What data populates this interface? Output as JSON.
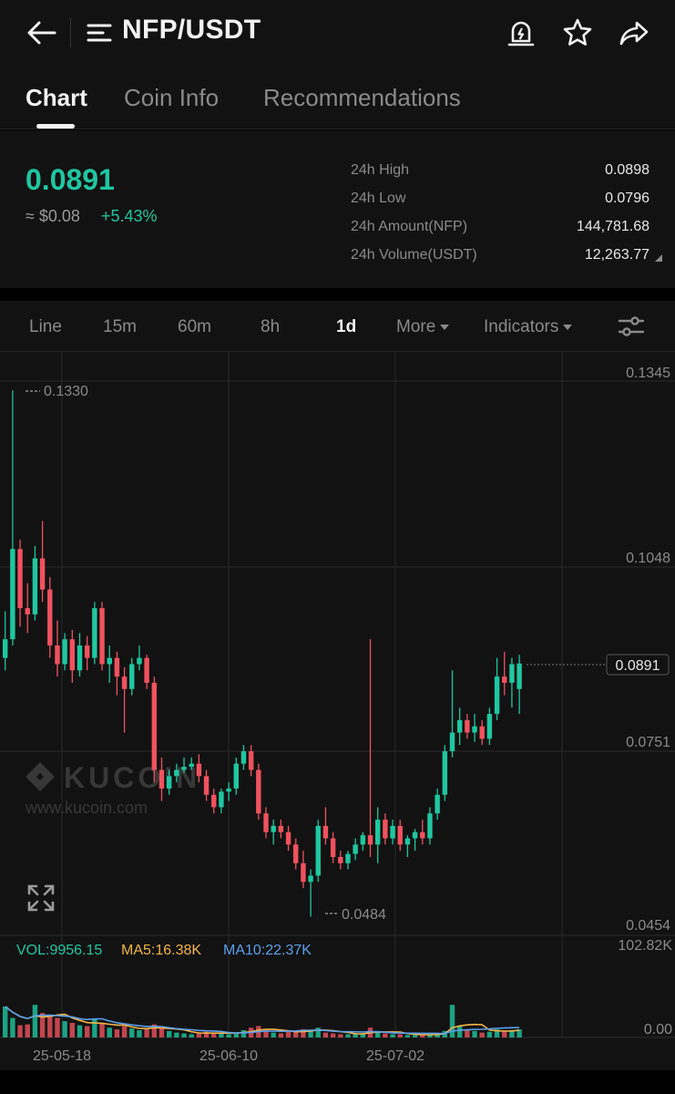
{
  "header": {
    "pair": "NFP/USDT",
    "icons": [
      "back-arrow-icon",
      "menu-icon",
      "price-alert-icon",
      "star-icon",
      "share-icon"
    ]
  },
  "tabs": [
    {
      "label": "Chart",
      "active": true
    },
    {
      "label": "Coin Info",
      "active": false
    },
    {
      "label": "Recommendations",
      "active": false
    }
  ],
  "ticker": {
    "last_price": "0.0891",
    "fiat_price": "≈ $0.08",
    "change_pct": "+5.43%",
    "stats": [
      {
        "label": "24h High",
        "value": "0.0898"
      },
      {
        "label": "24h Low",
        "value": "0.0796"
      },
      {
        "label": "24h Amount(NFP)",
        "value": "144,781.68"
      },
      {
        "label": "24h Volume(USDT)",
        "value": "12,263.77"
      }
    ]
  },
  "intervals": {
    "items": [
      {
        "label": "Line",
        "active": false
      },
      {
        "label": "15m",
        "active": false
      },
      {
        "label": "60m",
        "active": false
      },
      {
        "label": "8h",
        "active": false
      },
      {
        "label": "1d",
        "active": true
      }
    ],
    "more": "More",
    "indicators": "Indicators"
  },
  "colors": {
    "up": "#1fc7a0",
    "down": "#f0525e",
    "ma5": "#f4b547",
    "ma10": "#5aa0ec",
    "background": "#121212"
  },
  "watermark": {
    "brand": "KUCOIN",
    "url": "www.kucoin.com"
  },
  "chart_data": {
    "type": "candlestick",
    "interval": "1d",
    "price_axis_ticks": [
      "0.1345",
      "0.1048",
      "0.0751",
      "0.0454"
    ],
    "ylim": [
      0.0454,
      0.1345
    ],
    "current_price_label": "0.0891",
    "max_marker": "0.1330",
    "min_marker": "0.0484",
    "x_tick_labels": [
      "25-05-18",
      "25-06-10",
      "25-07-02"
    ],
    "volume": {
      "vol_label": "VOL:9956.15",
      "ma5_label": "MA5:16.38K",
      "ma10_label": "MA10:22.37K",
      "axis_ticks": [
        "102.82K",
        "0.00"
      ],
      "ylim": [
        0,
        102820
      ]
    },
    "candles": [
      [
        0.09,
        0.0975,
        0.088,
        0.093,
        38
      ],
      [
        0.093,
        0.133,
        0.092,
        0.1075,
        24
      ],
      [
        0.1075,
        0.109,
        0.095,
        0.098,
        15
      ],
      [
        0.098,
        0.102,
        0.094,
        0.097,
        16
      ],
      [
        0.097,
        0.108,
        0.096,
        0.106,
        40
      ],
      [
        0.106,
        0.112,
        0.099,
        0.101,
        30
      ],
      [
        0.101,
        0.103,
        0.09,
        0.092,
        28
      ],
      [
        0.092,
        0.096,
        0.087,
        0.089,
        24
      ],
      [
        0.089,
        0.094,
        0.088,
        0.093,
        20
      ],
      [
        0.093,
        0.0945,
        0.086,
        0.088,
        18
      ],
      [
        0.088,
        0.094,
        0.087,
        0.092,
        15
      ],
      [
        0.092,
        0.0935,
        0.088,
        0.09,
        14
      ],
      [
        0.09,
        0.099,
        0.089,
        0.098,
        22
      ],
      [
        0.098,
        0.099,
        0.088,
        0.089,
        18
      ],
      [
        0.089,
        0.092,
        0.086,
        0.09,
        12
      ],
      [
        0.09,
        0.091,
        0.084,
        0.087,
        10
      ],
      [
        0.087,
        0.0885,
        0.078,
        0.085,
        14
      ],
      [
        0.085,
        0.09,
        0.084,
        0.089,
        11
      ],
      [
        0.089,
        0.092,
        0.088,
        0.09,
        9
      ],
      [
        0.09,
        0.0905,
        0.085,
        0.086,
        10
      ],
      [
        0.086,
        0.087,
        0.07,
        0.072,
        16
      ],
      [
        0.072,
        0.074,
        0.067,
        0.069,
        12
      ],
      [
        0.069,
        0.072,
        0.068,
        0.071,
        8
      ],
      [
        0.071,
        0.073,
        0.07,
        0.072,
        6
      ],
      [
        0.072,
        0.074,
        0.0715,
        0.0725,
        5
      ],
      [
        0.0725,
        0.074,
        0.072,
        0.073,
        4
      ],
      [
        0.073,
        0.0745,
        0.07,
        0.071,
        5
      ],
      [
        0.071,
        0.072,
        0.067,
        0.068,
        7
      ],
      [
        0.068,
        0.069,
        0.065,
        0.066,
        6
      ],
      [
        0.066,
        0.069,
        0.065,
        0.0685,
        5
      ],
      [
        0.0685,
        0.07,
        0.067,
        0.069,
        4
      ],
      [
        0.069,
        0.074,
        0.068,
        0.073,
        6
      ],
      [
        0.073,
        0.076,
        0.072,
        0.075,
        9
      ],
      [
        0.075,
        0.076,
        0.071,
        0.072,
        12
      ],
      [
        0.072,
        0.073,
        0.064,
        0.065,
        14
      ],
      [
        0.065,
        0.066,
        0.061,
        0.062,
        9
      ],
      [
        0.062,
        0.064,
        0.06,
        0.063,
        6
      ],
      [
        0.063,
        0.064,
        0.061,
        0.062,
        5
      ],
      [
        0.062,
        0.063,
        0.059,
        0.06,
        7
      ],
      [
        0.06,
        0.061,
        0.056,
        0.057,
        8
      ],
      [
        0.057,
        0.059,
        0.053,
        0.054,
        10
      ],
      [
        0.054,
        0.056,
        0.0484,
        0.055,
        9
      ],
      [
        0.055,
        0.064,
        0.054,
        0.063,
        12
      ],
      [
        0.063,
        0.066,
        0.06,
        0.061,
        6
      ],
      [
        0.061,
        0.062,
        0.057,
        0.058,
        5
      ],
      [
        0.058,
        0.059,
        0.056,
        0.057,
        4
      ],
      [
        0.057,
        0.059,
        0.056,
        0.0585,
        4
      ],
      [
        0.0585,
        0.061,
        0.0575,
        0.06,
        4
      ],
      [
        0.06,
        0.062,
        0.059,
        0.0615,
        5
      ],
      [
        0.0615,
        0.093,
        0.058,
        0.06,
        12
      ],
      [
        0.06,
        0.066,
        0.057,
        0.064,
        8
      ],
      [
        0.064,
        0.065,
        0.06,
        0.061,
        5
      ],
      [
        0.061,
        0.064,
        0.06,
        0.063,
        4
      ],
      [
        0.063,
        0.064,
        0.059,
        0.06,
        4
      ],
      [
        0.06,
        0.0615,
        0.058,
        0.061,
        3
      ],
      [
        0.061,
        0.0625,
        0.059,
        0.062,
        3
      ],
      [
        0.062,
        0.064,
        0.06,
        0.061,
        3
      ],
      [
        0.061,
        0.066,
        0.06,
        0.065,
        4
      ],
      [
        0.065,
        0.069,
        0.064,
        0.068,
        5
      ],
      [
        0.068,
        0.076,
        0.067,
        0.075,
        8
      ],
      [
        0.075,
        0.088,
        0.074,
        0.078,
        40
      ],
      [
        0.078,
        0.082,
        0.076,
        0.08,
        14
      ],
      [
        0.08,
        0.081,
        0.077,
        0.078,
        10
      ],
      [
        0.078,
        0.081,
        0.0765,
        0.079,
        8
      ],
      [
        0.079,
        0.08,
        0.076,
        0.077,
        6
      ],
      [
        0.077,
        0.082,
        0.076,
        0.081,
        7
      ],
      [
        0.081,
        0.09,
        0.08,
        0.087,
        10
      ],
      [
        0.087,
        0.091,
        0.084,
        0.086,
        8
      ],
      [
        0.086,
        0.09,
        0.082,
        0.089,
        9
      ],
      [
        0.085,
        0.0905,
        0.081,
        0.0891,
        10
      ]
    ]
  }
}
